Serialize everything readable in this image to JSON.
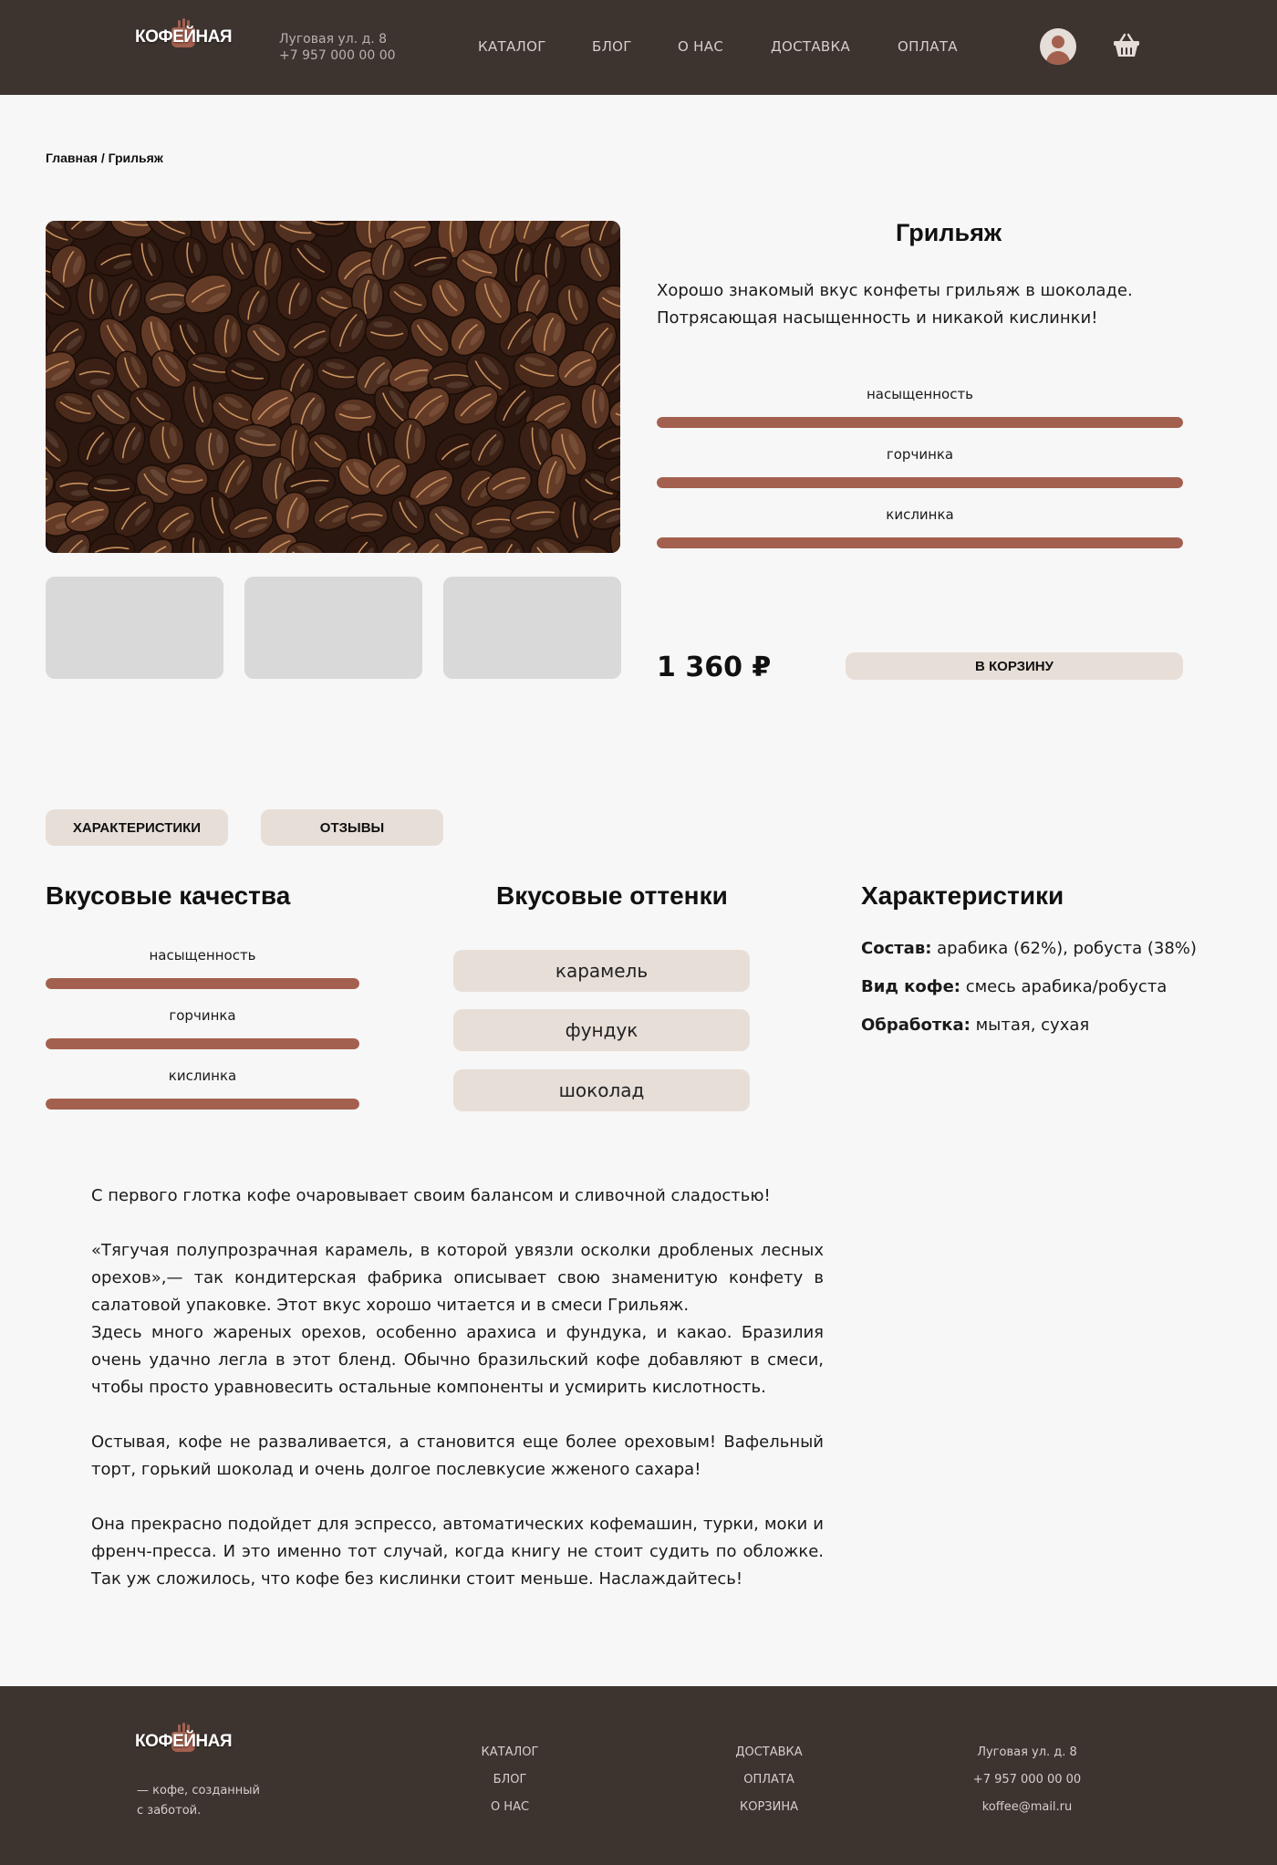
{
  "brand": {
    "name": "КОФЕЙНАЯ",
    "tagline_line1": "— кофе, созданный",
    "tagline_line2": "с заботой."
  },
  "header": {
    "address": "Луговая ул. д. 8",
    "phone": "+7 957 000 00 00",
    "nav": [
      "КАТАЛОГ",
      "БЛОГ",
      "О НАС",
      "ДОСТАВКА",
      "ОПЛАТА"
    ]
  },
  "breadcrumb": "Главная / Грильяж",
  "product": {
    "title": "Грильяж",
    "description_line1": "Хорошо знакомый вкус конфеты грильяж в шоколаде.",
    "description_line2": "Потрясающая насыщенность и никакой кислинки!",
    "scales": [
      {
        "label": "насыщенность",
        "level": 1.0
      },
      {
        "label": "горчинка",
        "level": 1.0
      },
      {
        "label": "кислинка",
        "level": 1.0
      }
    ],
    "price": "1 360 ₽",
    "add_to_cart": "В КОРЗИНУ"
  },
  "tabs": [
    "ХАРАКТЕРИСТИКИ",
    "ОТЗЫВЫ"
  ],
  "taste": {
    "title": "Вкусовые качества",
    "scales": [
      {
        "label": "насыщенность",
        "level": 1.0
      },
      {
        "label": "горчинка",
        "level": 1.0
      },
      {
        "label": "кислинка",
        "level": 1.0
      }
    ]
  },
  "notes": {
    "title": "Вкусовые оттенки",
    "items": [
      "карамель",
      "фундук",
      "шоколад"
    ]
  },
  "specs": {
    "title": "Характеристики",
    "items": [
      {
        "key": "Состав:",
        "value": " арабика (62%), робуста (38%)"
      },
      {
        "key": "Вид кофе:",
        "value": " смесь арабика/робуста"
      },
      {
        "key": "Обработка:",
        "value": " мытая, сухая"
      }
    ]
  },
  "story": {
    "p1": "С первого глотка кофе очаровывает своим балансом и сливочной сладостью!",
    "p2": "«Тягучая полупрозрачная карамель, в которой увязли осколки дробленых лесных орехов»,— так кондитерская фабрика описывает свою знаменитую конфету в салатовой упаковке. Этот вкус хорошо читается и в смеси Грильяж.",
    "p3": "Здесь много жареных орехов, особенно арахиса и фундука, и какао. Бразилия очень удачно легла в этот бленд. Обычно бразильский кофе добавляют в смеси, чтобы просто уравновесить остальные компоненты и усмирить кислотность.",
    "p4": "Остывая, кофе не разваливается, а становится еще более ореховым! Вафельный торт, горький шоколад и очень долгое послевкусие жженого сахара!",
    "p5": "Она прекрасно подойдет для эспрессо, автоматических кофемашин, турки, моки и френч-пресса. И это именно тот случай, когда книгу не стоит судить по обложке. Так уж сложилось, что кофе без кислинки стоит меньше. Наслаждайтесь!"
  },
  "footer": {
    "col1": [
      "КАТАЛОГ",
      "БЛОГ",
      "О НАС"
    ],
    "col2": [
      "ДОСТАВКА",
      "ОПЛАТА",
      "КОРЗИНА"
    ],
    "col3": [
      "Луговая ул. д. 8",
      "+7 957 000 00 00",
      "koffee@mail.ru"
    ]
  },
  "icons": {
    "user": "user-icon",
    "cart": "basket-icon",
    "logo": "coffee-cup-icon"
  },
  "colors": {
    "header_bg": "#3d3430",
    "accent": "#a4604f",
    "chip_bg": "#e7ded8",
    "page_bg": "#f7f7f7"
  }
}
